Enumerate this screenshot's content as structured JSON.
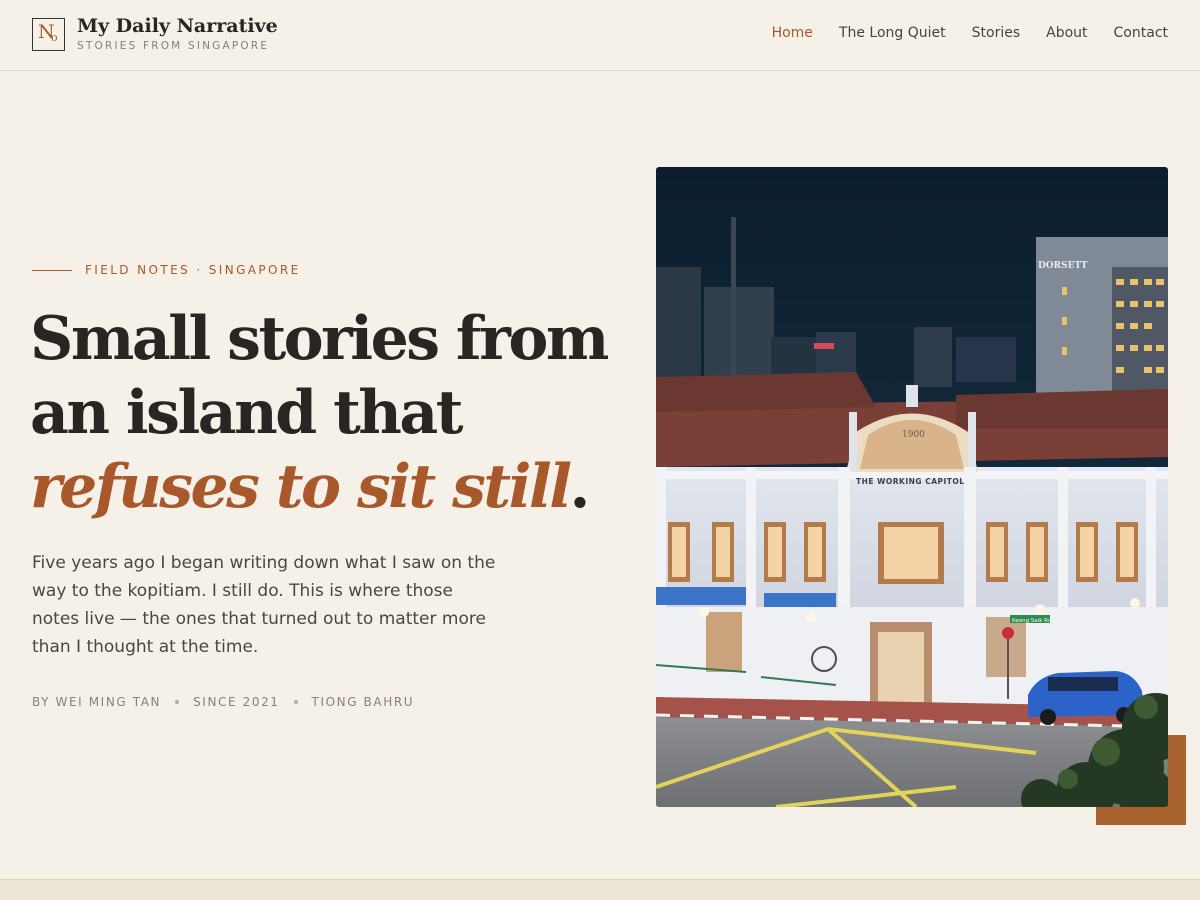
{
  "brand": {
    "title": "My Daily Narrative",
    "subtitle": "STORIES FROM SINGAPORE",
    "logo_icon": "monogram-no-icon"
  },
  "nav": {
    "items": [
      {
        "label": "Home",
        "active": true
      },
      {
        "label": "The Long Quiet",
        "active": false
      },
      {
        "label": "Stories",
        "active": false
      },
      {
        "label": "About",
        "active": false
      },
      {
        "label": "Contact",
        "active": false
      }
    ]
  },
  "hero": {
    "eyebrow": "FIELD NOTES · SINGAPORE",
    "headline_line1": "Small stories from",
    "headline_line2": "an island that",
    "headline_accent": "refuses to sit still",
    "headline_period": ".",
    "lede": "Five years ago I began writing down what I saw on the way to the kopitiam. I still do. This is where those notes live — the ones that turned out to matter more than I thought at the time.",
    "meta": [
      "BY WEI MING TAN",
      "SINCE 2021",
      "TIONG BAHRU"
    ]
  },
  "photo": {
    "sign_hotel": "DORSETT",
    "sign_building": "THE WORKING CAPITOL",
    "sign_year": "1900",
    "sign_street": "Keong Saik Rd"
  },
  "colors": {
    "accent": "#a8582a",
    "background": "#f5f0e8",
    "text": "#2a2522"
  }
}
